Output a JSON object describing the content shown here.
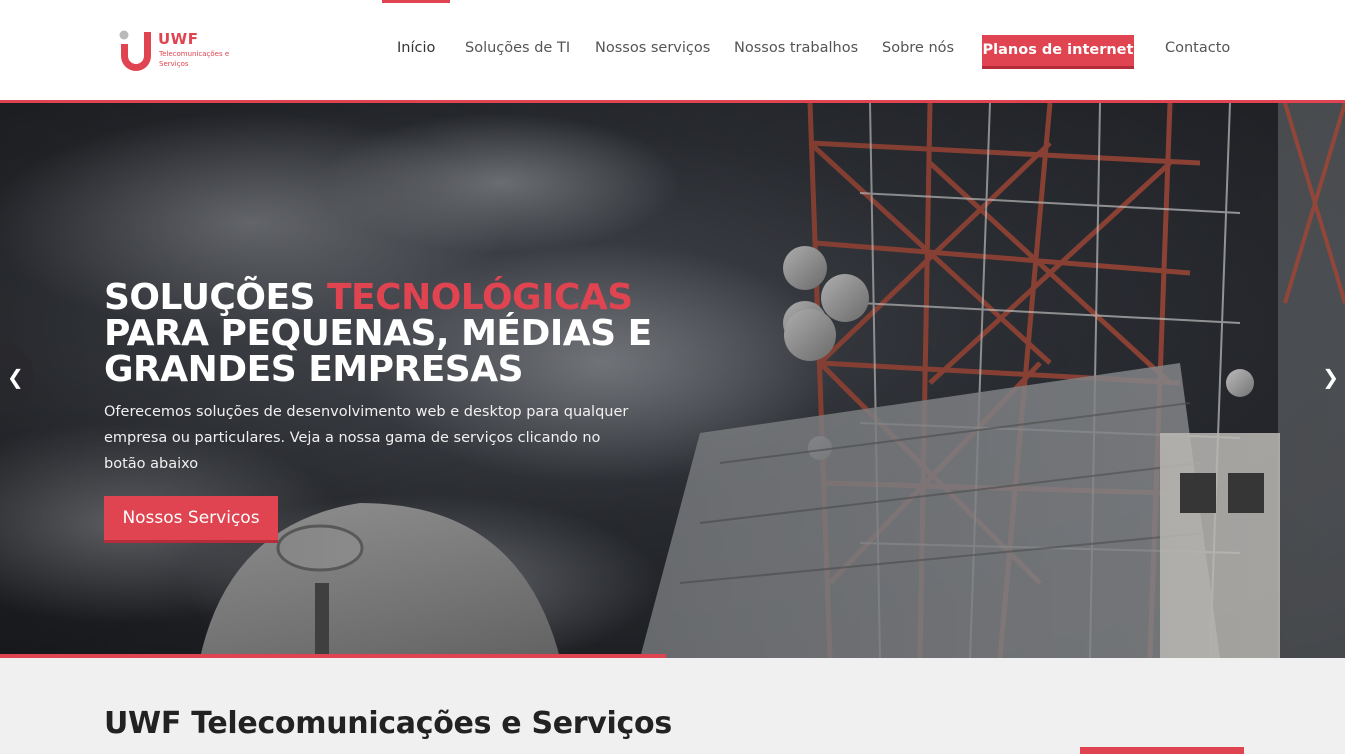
{
  "logo": {
    "brand": "UWF",
    "subtitle": "Telecomunicações e Serviços"
  },
  "nav": {
    "items": [
      {
        "label": "Início",
        "active": true
      },
      {
        "label": "Soluções de TI"
      },
      {
        "label": "Nossos serviços"
      },
      {
        "label": "Nossos trabalhos"
      },
      {
        "label": "Sobre nós"
      }
    ],
    "cta_label": "Planos de internet",
    "contact_label": "Contacto"
  },
  "hero": {
    "title_part1": "SOLUÇÕES ",
    "title_accent": "TECNOLÓGICAS",
    "title_part2": "PARA PEQUENAS, MÉDIAS E GRANDES EMPRESAS",
    "description": "Oferecemos soluções de desenvolvimento web e desktop para qualquer empresa ou particulares. Veja a nossa gama de serviços clicando no botão abaixo",
    "button_label": "Nossos Serviços",
    "prev_icon": "chevron-left-icon",
    "next_icon": "chevron-right-icon",
    "slide_progress": 0.495
  },
  "intro": {
    "title": "UWF Telecomunicações e Serviços"
  },
  "colors": {
    "accent": "#e04450",
    "accent_dark": "#b52d39",
    "nav_text": "#555555"
  }
}
